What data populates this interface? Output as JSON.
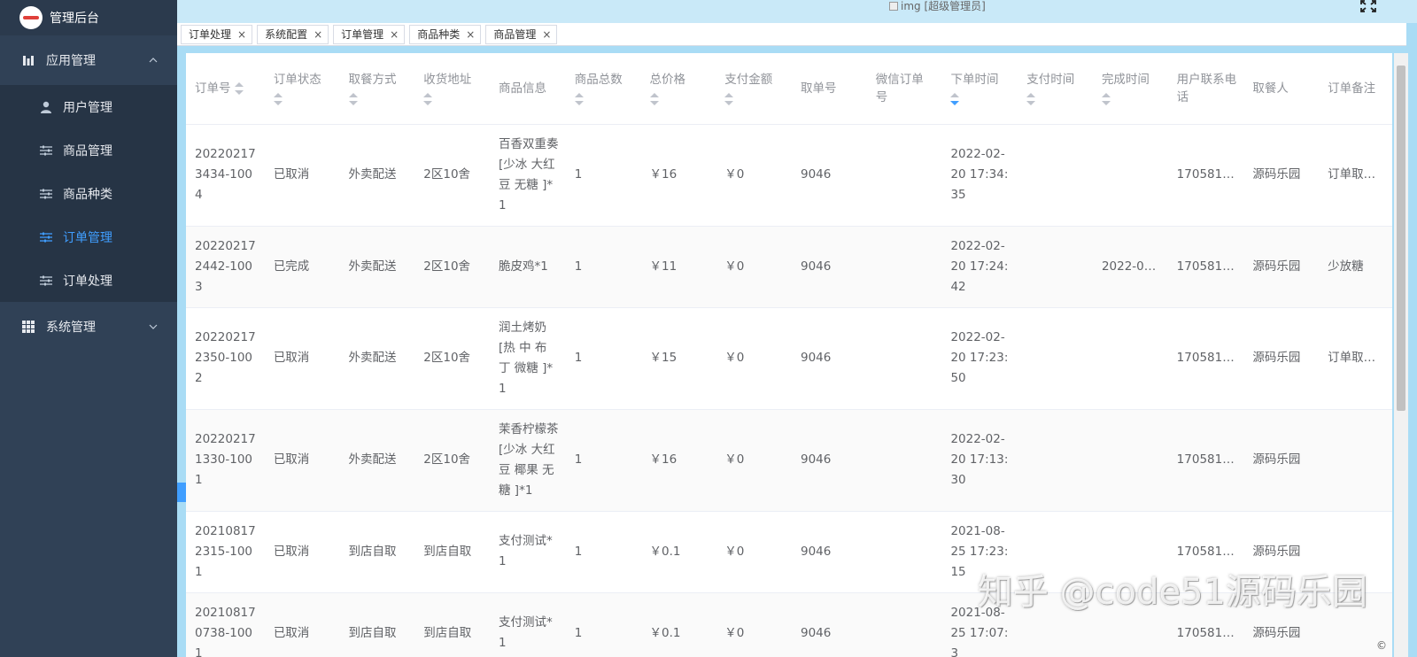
{
  "brand": {
    "title": "管理后台"
  },
  "sidebar": {
    "groups": [
      {
        "label": "应用管理",
        "icon": "chart-icon",
        "expanded": true,
        "items": [
          {
            "label": "用户管理",
            "icon": "user-icon",
            "active": false
          },
          {
            "label": "商品管理",
            "icon": "sliders-icon",
            "active": false
          },
          {
            "label": "商品种类",
            "icon": "sliders-icon",
            "active": false
          },
          {
            "label": "订单管理",
            "icon": "sliders-icon",
            "active": true
          },
          {
            "label": "订单处理",
            "icon": "sliders-icon",
            "active": false
          }
        ]
      },
      {
        "label": "系统管理",
        "icon": "grid-icon",
        "expanded": false
      }
    ]
  },
  "header": {
    "avatar_alt": "img",
    "role": "[超级管理员]"
  },
  "tags": [
    "订单处理",
    "系统配置",
    "订单管理",
    "商品种类",
    "商品管理"
  ],
  "tag_close": "×",
  "table": {
    "columns": [
      "订单号",
      "订单状态",
      "取餐方式",
      "收货地址",
      "商品信息",
      "商品总数",
      "总价格",
      "支付金额",
      "取单号",
      "微信订单号",
      "下单时间",
      "支付时间",
      "完成时间",
      "用户联系电话",
      "取餐人",
      "订单备注"
    ],
    "rows": [
      [
        "202202173434-1004",
        "已取消",
        "外卖配送",
        "2区10舍",
        "百香双重奏[少冰 大红豆 无糖 ]*1",
        "1",
        "￥16",
        "￥0",
        "9046",
        "",
        "2022-02-20 17:34:35",
        "",
        "",
        "170581…",
        "源码乐园",
        "订单取…"
      ],
      [
        "202202172442-1003",
        "已完成",
        "外卖配送",
        "2区10舍",
        "脆皮鸡*1",
        "1",
        "￥11",
        "￥0",
        "9046",
        "",
        "2022-02-20 17:24:42",
        "",
        "2022-0…",
        "170581…",
        "源码乐园",
        "少放糖"
      ],
      [
        "202202172350-1002",
        "已取消",
        "外卖配送",
        "2区10舍",
        "润土烤奶[热 中 布丁 微糖 ]*1",
        "1",
        "￥15",
        "￥0",
        "9046",
        "",
        "2022-02-20 17:23:50",
        "",
        "",
        "170581…",
        "源码乐园",
        "订单取…"
      ],
      [
        "202202171330-1001",
        "已取消",
        "外卖配送",
        "2区10舍",
        "茉香柠檬茶[少冰 大红豆 椰果 无糖 ]*1",
        "1",
        "￥16",
        "￥0",
        "9046",
        "",
        "2022-02-20 17:13:30",
        "",
        "",
        "170581…",
        "源码乐园",
        ""
      ],
      [
        "202108172315-1001",
        "已取消",
        "到店自取",
        "到店自取",
        "支付测试*1",
        "1",
        "￥0.1",
        "￥0",
        "9046",
        "",
        "2021-08-25 17:23:15",
        "",
        "",
        "170581…",
        "源码乐园",
        ""
      ],
      [
        "202108170738-1001",
        "已取消",
        "到店自取",
        "到店自取",
        "支付测试*1",
        "1",
        "￥0.1",
        "￥0",
        "9046",
        "",
        "2021-08-25 17:07:3",
        "",
        "",
        "170581…",
        "源码乐园",
        ""
      ]
    ]
  },
  "watermark": "知乎 @code51源码乐园",
  "copyright": "©"
}
